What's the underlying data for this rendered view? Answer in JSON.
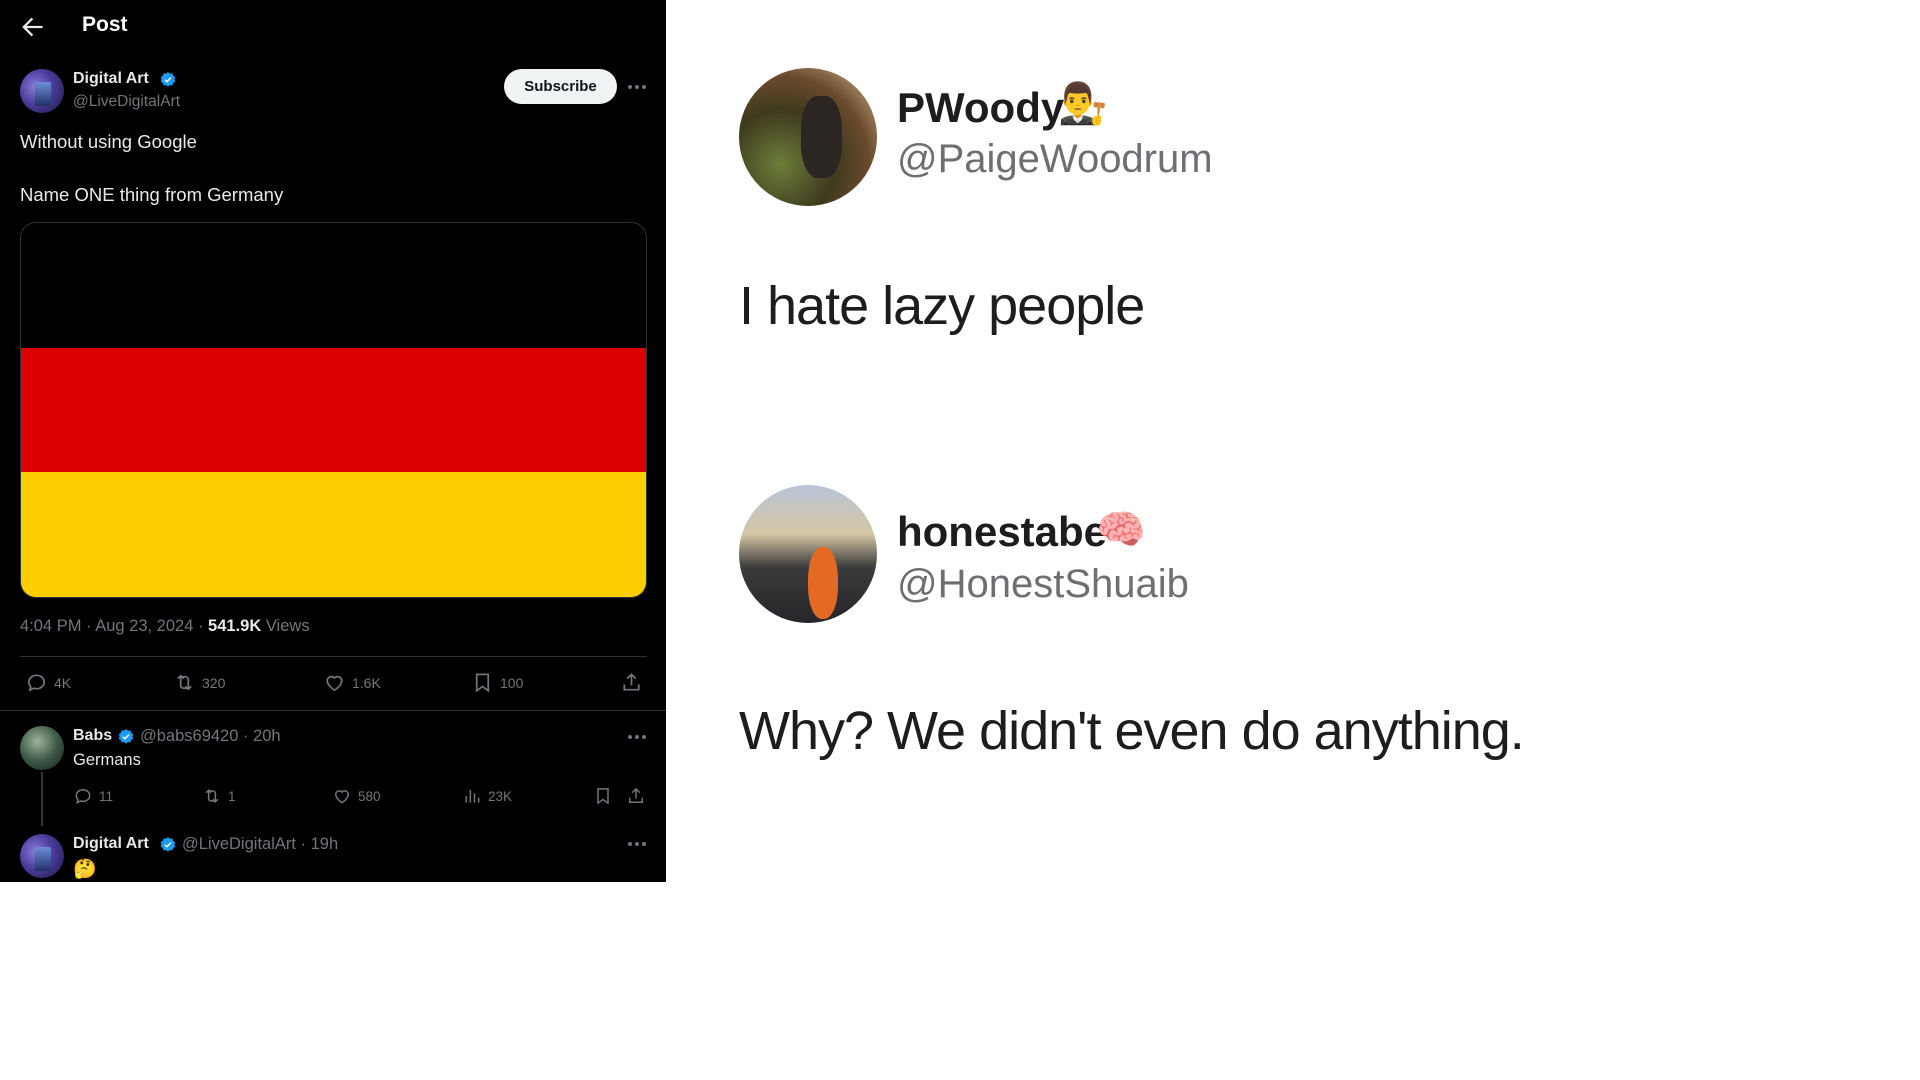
{
  "post_header": {
    "title": "Post"
  },
  "post": {
    "author_name": "Digital Art",
    "author_handle": "@LiveDigitalArt",
    "subscribe_label": "Subscribe",
    "text_line1": "Without using Google",
    "text_line2": "Name ONE thing from Germany",
    "flag_colors": [
      "#000000",
      "#dd0000",
      "#ffce00"
    ],
    "timestamp": "4:04 PM · Aug 23, 2024 · ",
    "views_count": "541.9K",
    "views_label": " Views",
    "replies": "4K",
    "reposts": "320",
    "likes": "1.6K",
    "bookmarks": "100"
  },
  "replies": [
    {
      "author_name": "Babs",
      "author_handle": "@babs69420 · 20h",
      "text": "Germans",
      "replies": "11",
      "reposts": "1",
      "likes": "580",
      "views": "23K"
    },
    {
      "author_name": "Digital Art",
      "author_handle": "@LiveDigitalArt · 19h",
      "text": "🤔"
    }
  ],
  "meme": {
    "tweet1": {
      "name": "PWoody",
      "emoji": "👨‍⚖️",
      "handle": "@PaigeWoodrum",
      "text": "I hate lazy people"
    },
    "tweet2": {
      "name": "honestabe",
      "emoji": "🧠",
      "handle": "@HonestShuaib",
      "text": "Why? We didn't even do anything."
    }
  },
  "colors": {
    "verified": "#1d9bf0",
    "background": "#000000",
    "muted": "#71767b"
  }
}
